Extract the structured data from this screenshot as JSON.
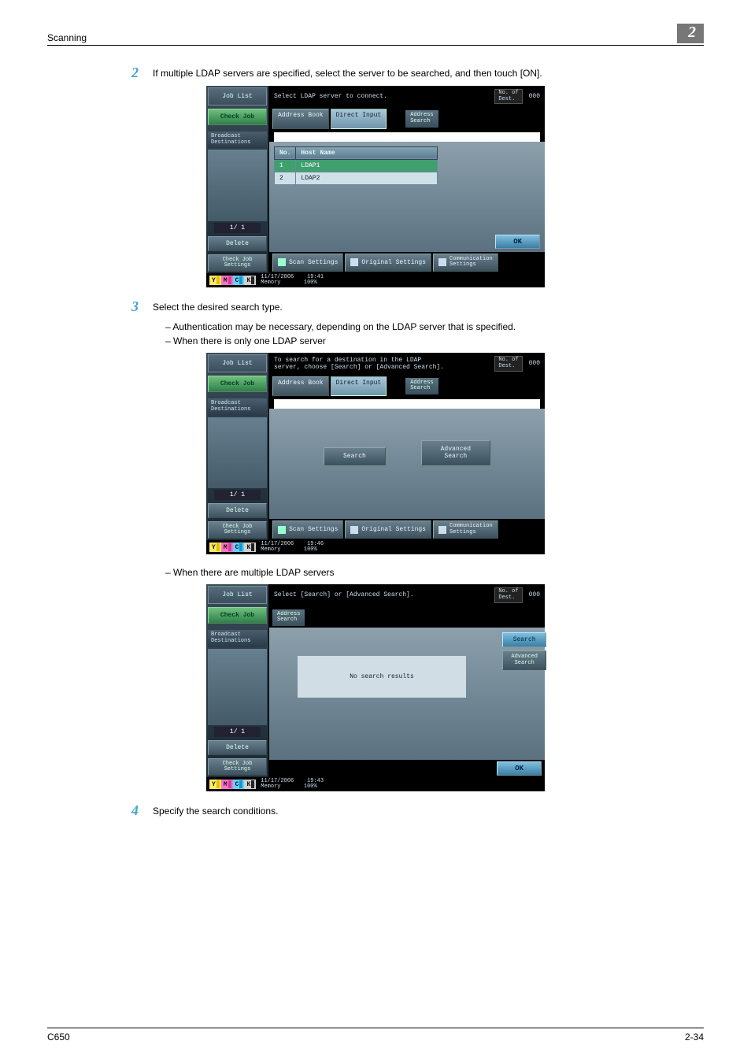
{
  "header": {
    "section": "Scanning",
    "chapter": "2"
  },
  "footer": {
    "model": "C650",
    "page": "2-34"
  },
  "steps": {
    "s2": {
      "num": "2",
      "text": "If multiple LDAP servers are specified, select the server to be searched, and then touch [ON]."
    },
    "s3": {
      "num": "3",
      "text": "Select the desired search type.",
      "sub1": "Authentication may be necessary, depending on the LDAP server that is specified.",
      "sub2": "When there is only one LDAP server",
      "sub3": "When there are multiple LDAP servers"
    },
    "s4": {
      "num": "4",
      "text": "Specify the search conditions."
    }
  },
  "common": {
    "job_list": "Job List",
    "check_job": "Check Job",
    "broadcast": "Broadcast\nDestinations",
    "pager": "1/  1",
    "delete": "Delete",
    "check_job_settings": "Check Job\nSettings",
    "addr_book": "Address Book",
    "direct_input": "Direct Input",
    "addr_search": "Address\nSearch",
    "scan_settings": "Scan Settings",
    "orig_settings": "Original Settings",
    "comm_settings": "Communication\nSettings",
    "dest_label": "No. of\nDest.",
    "dest_val": "000",
    "ok": "OK",
    "mem_label": "Memory",
    "mem_val": "100%",
    "toners": {
      "y": "Y",
      "m": "M",
      "c": "C",
      "k": "K"
    }
  },
  "screen1": {
    "msg": "Select LDAP server to connect.",
    "th_no": "No.",
    "th_host": "Host Name",
    "rows": [
      {
        "no": "1",
        "host": "LDAP1",
        "selected": true
      },
      {
        "no": "2",
        "host": "LDAP2",
        "selected": false
      }
    ],
    "date": "11/17/2006",
    "time": "19:41"
  },
  "screen2": {
    "msg": "To search for a destination in the LDAP\nserver, choose [Search] or [Advanced Search].",
    "search": "Search",
    "adv": "Advanced\nSearch",
    "date": "11/17/2006",
    "time": "19:46"
  },
  "screen3": {
    "msg": "Select [Search] or [Advanced Search].",
    "no_results": "No search results",
    "search": "Search",
    "adv": "Advanced\nSearch",
    "date": "11/17/2006",
    "time": "19:43"
  }
}
